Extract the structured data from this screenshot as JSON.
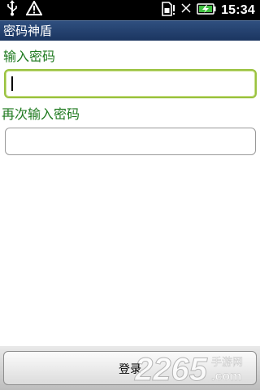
{
  "status_bar": {
    "time": "15:34",
    "icons": [
      "usb-icon",
      "warning-icon",
      "sim-card-icon",
      "signal-icon",
      "battery-charging-icon"
    ]
  },
  "app": {
    "title": "密码神盾"
  },
  "form": {
    "password_label": "输入密码",
    "password_value": "",
    "confirm_label": "再次输入密码",
    "confirm_value": ""
  },
  "actions": {
    "login_label": "登录"
  },
  "watermark": {
    "brand": "2265",
    "domain": ".com",
    "tagline": "手游网"
  },
  "colors": {
    "label_green": "#1f7a1f",
    "title_blue": "#1b3560",
    "focus_border": "#9ac23f"
  }
}
